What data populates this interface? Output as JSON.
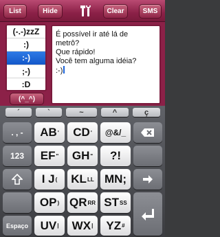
{
  "toolbar": {
    "list_label": "List",
    "hide_label": "Hide",
    "tools_icon": "wrench-screwdriver-icon",
    "clear_label": "Clear",
    "sms_label": "SMS"
  },
  "emoticons": {
    "items": [
      "(-.-)zzZ",
      ":)",
      ":-)",
      ";-)",
      ":D"
    ],
    "selected_index": 2,
    "sample_button": "(^_^)"
  },
  "editor": {
    "lines": [
      "É possível ir até lá de",
      "metrô?",
      "Que rápido!",
      "Você tem alguma idéia?",
      ":-)"
    ]
  },
  "keyboard": {
    "accent_row": [
      "´",
      "`",
      "~",
      "^",
      "ç"
    ],
    "rows": [
      {
        "left": ". , -",
        "keys": [
          {
            "main": "AB",
            "sup": "'"
          },
          {
            "main": "CD",
            "sup": "'"
          },
          {
            "main": "@&/_",
            "sup": ""
          }
        ],
        "right_icon": "backspace-icon"
      },
      {
        "left": "123",
        "keys": [
          {
            "main": "EF",
            "sup": "\""
          },
          {
            "main": "GH",
            "sup": "\""
          },
          {
            "main": "?!",
            "sup": ""
          }
        ],
        "right_icon": ""
      },
      {
        "left_icon": "shift-up-arrow-icon",
        "keys": [
          {
            "main": "I J",
            "sup": "("
          },
          {
            "main": "KL",
            "sup": "LL"
          },
          {
            "main": "MN;",
            "sup": ""
          }
        ],
        "right_icon": "right-arrow-icon"
      },
      {
        "left_icon": "",
        "keys": [
          {
            "main": "OP",
            "sup": ")"
          },
          {
            "main": "QR",
            "sup": "RR"
          },
          {
            "main": "ST",
            "sup": "SS"
          }
        ],
        "right_icon": ""
      },
      {
        "left": "Espaço",
        "keys": [
          {
            "main": "UV",
            "sup": "|"
          },
          {
            "main": "WX",
            "sup": "|"
          },
          {
            "main": "YZ",
            "sup": "#"
          }
        ],
        "right_icon": "return-icon"
      }
    ]
  }
}
